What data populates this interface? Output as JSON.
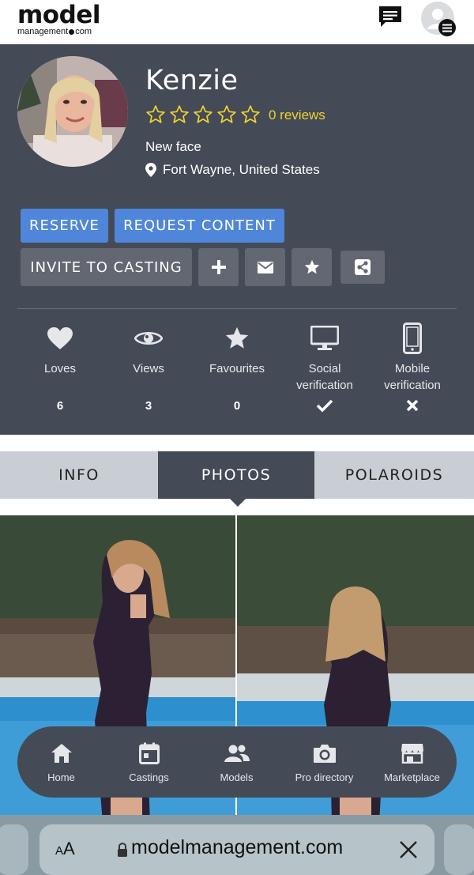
{
  "brand": {
    "name": "model",
    "sub_left": "management",
    "sub_right": "com"
  },
  "profile": {
    "name": "Kenzie",
    "rating_stars": 0,
    "rating_max": 5,
    "reviews": "0 reviews",
    "subtitle": "New face",
    "location": "Fort Wayne, United States"
  },
  "actions": {
    "reserve": "RESERVE",
    "request_content": "REQUEST CONTENT",
    "invite": "INVITE TO CASTING"
  },
  "stats": [
    {
      "icon": "heart-icon",
      "label": "Loves",
      "value": "6"
    },
    {
      "icon": "eye-icon",
      "label": "Views",
      "value": "3"
    },
    {
      "icon": "star-icon",
      "label": "Favourites",
      "value": "0"
    },
    {
      "icon": "monitor-icon",
      "label": "Social verification",
      "value": "✔"
    },
    {
      "icon": "mobile-icon",
      "label": "Mobile verification",
      "value": "✖"
    }
  ],
  "tabs": {
    "info": "INFO",
    "photos": "PHOTOS",
    "polaroids": "POLAROIDS",
    "active": "PHOTOS"
  },
  "nav": {
    "home": "Home",
    "castings": "Castings",
    "models": "Models",
    "pro_directory": "Pro directory",
    "marketplace": "Marketplace"
  },
  "browser": {
    "aa_small": "A",
    "aa_big": "A",
    "url": "modelmanagement.com"
  },
  "colors": {
    "panel": "#444a56",
    "accent_blue": "#4f86d9",
    "star_yellow": "#f0d330",
    "tab_inactive": "#c8ced3"
  }
}
